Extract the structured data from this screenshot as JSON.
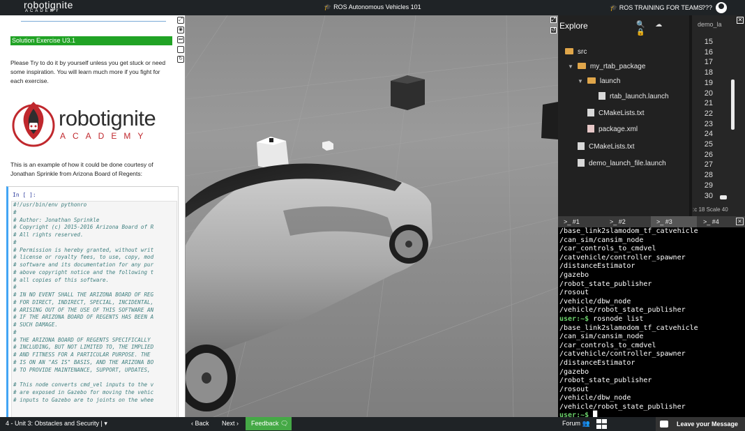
{
  "topbar": {
    "logo_line1": "robotignite",
    "logo_line2": "ACADEMY",
    "course_title": "ROS Autonomous Vehicles 101",
    "training_link": "ROS TRAINING FOR TEAMS",
    "help": "???",
    "course_icon": "graduation-cap-icon",
    "avatar_icon": "user-avatar-icon"
  },
  "notebook": {
    "solution_header": "Solution Exercise U3.1",
    "intro": "Please Try to do it by yourself unless you get stuck or need some inspiration. You will learn much more if you fight for each exercise.",
    "logo_word1": "robotignite",
    "logo_word2": "ACADEMY",
    "example_text": "This is an example of how it could be done courtesy of Jonathan Sprinkle from Arizona Board of Regents:",
    "cell_prompt": "In [ ]:",
    "code_lines": [
      "#!/usr/bin/env pythonro",
      "#",
      "# Author: Jonathan Sprinkle",
      "# Copyright (c) 2015-2016 Arizona Board of R",
      "# All rights reserved.",
      "#",
      "# Permission is hereby granted, without writ",
      "# license or royalty fees, to use, copy, mod",
      "# software and its documentation for any pur",
      "# above copyright notice and the following t",
      "# all copies of this software.",
      "#",
      "# IN NO EVENT SHALL THE ARIZONA BOARD OF REG",
      "# FOR DIRECT, INDIRECT, SPECIAL, INCIDENTAL,",
      "# ARISING OUT OF THE USE OF THIS SOFTWARE AN",
      "# IF THE ARIZONA BOARD OF REGENTS HAS BEEN A",
      "# SUCH DAMAGE.",
      "#",
      "# THE ARIZONA BOARD OF REGENTS SPECIFICALLY",
      "# INCLUDING, BUT NOT LIMITED TO, THE IMPLIED",
      "# AND FITNESS FOR A PARTICULAR PURPOSE. THE",
      "# IS ON AN \"AS IS\" BASIS, AND THE ARIZONA BO",
      "# TO PROVIDE MAINTENANCE, SUPPORT, UPDATES,",
      "",
      "# This node converts cmd_vel inputs to the v",
      "# are exposed in Gazebo for moving the vehic",
      "# inputs to Gazebo are to joints on the whee"
    ]
  },
  "explore": {
    "title": "Explore",
    "icons": [
      "search-icon",
      "cloud-icon",
      "lock-icon"
    ],
    "tree": [
      {
        "label": "src",
        "type": "folder",
        "depth": 0,
        "caret": ""
      },
      {
        "label": "my_rtab_package",
        "type": "folder",
        "depth": 1,
        "caret": "▼"
      },
      {
        "label": "launch",
        "type": "folder",
        "depth": 2,
        "caret": "▼"
      },
      {
        "label": "rtab_launch.launch",
        "type": "file",
        "depth": 3,
        "caret": ""
      },
      {
        "label": "CMakeLists.txt",
        "type": "file",
        "depth": 2,
        "caret": ""
      },
      {
        "label": "package.xml",
        "type": "xml",
        "depth": 2,
        "caret": ""
      },
      {
        "label": "CMakeLists.txt",
        "type": "file",
        "depth": 1,
        "caret": ""
      },
      {
        "label": "demo_launch_file.launch",
        "type": "file",
        "depth": 1,
        "caret": ""
      }
    ]
  },
  "editor": {
    "tab": "demo_la",
    "line_numbers": [
      "15",
      "16",
      "17",
      "18",
      "19",
      "20",
      "21",
      "22",
      "23",
      "24",
      "25",
      "26",
      "27",
      "28",
      "29",
      "30"
    ],
    "status": ":c 18 Scale 40"
  },
  "terminal": {
    "tabs": [
      ">_ #1",
      ">_ #2",
      ">_ #3",
      ">_ #4"
    ],
    "active_tab": 2,
    "lines": [
      {
        "prompt": "",
        "text": "/base_link2slamodom_tf_catvehicle"
      },
      {
        "prompt": "",
        "text": "/can_sim/cansim_node"
      },
      {
        "prompt": "",
        "text": "/car_controls_to_cmdvel"
      },
      {
        "prompt": "",
        "text": "/catvehicle/controller_spawner"
      },
      {
        "prompt": "",
        "text": "/distanceEstimator"
      },
      {
        "prompt": "",
        "text": "/gazebo"
      },
      {
        "prompt": "",
        "text": "/robot_state_publisher"
      },
      {
        "prompt": "",
        "text": "/rosout"
      },
      {
        "prompt": "",
        "text": "/vehicle/dbw_node"
      },
      {
        "prompt": "",
        "text": "/vehicle/robot_state_publisher"
      },
      {
        "prompt": "user:~$",
        "text": " rosnode list"
      },
      {
        "prompt": "",
        "text": "/base_link2slamodom_tf_catvehicle"
      },
      {
        "prompt": "",
        "text": "/can_sim/cansim_node"
      },
      {
        "prompt": "",
        "text": "/car_controls_to_cmdvel"
      },
      {
        "prompt": "",
        "text": "/catvehicle/controller_spawner"
      },
      {
        "prompt": "",
        "text": "/distanceEstimator"
      },
      {
        "prompt": "",
        "text": "/gazebo"
      },
      {
        "prompt": "",
        "text": "/robot_state_publisher"
      },
      {
        "prompt": "",
        "text": "/rosout"
      },
      {
        "prompt": "",
        "text": "/vehicle/dbw_node"
      },
      {
        "prompt": "",
        "text": "/vehicle/robot_state_publisher"
      },
      {
        "prompt": "user:~$",
        "text": " █"
      }
    ]
  },
  "bottombar": {
    "unit": "4 - Unit 3: Obstacles and Security |",
    "back": "Back",
    "next": "Next",
    "feedback": "Feedback",
    "forum": "Forum",
    "leave_message": "Leave your Message"
  },
  "colors": {
    "solution_green": "#21a325",
    "feedback_green": "#45a946",
    "brand_red": "#c0282d",
    "terminal_prompt": "#6bd16b"
  }
}
